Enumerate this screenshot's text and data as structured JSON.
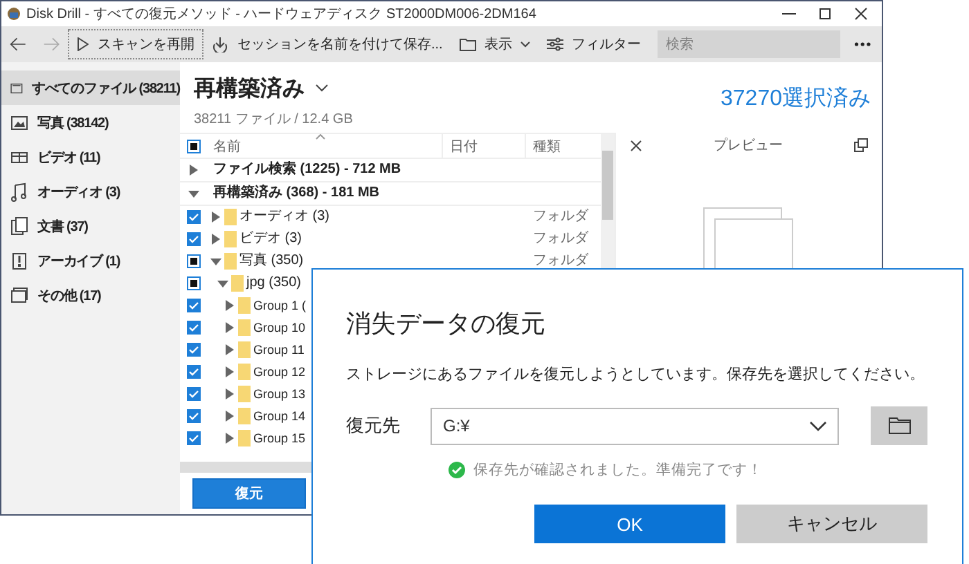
{
  "window": {
    "title": "Disk Drill - すべての復元メソッド - ハードウェアディスク ST2000DM006-2DM164"
  },
  "toolbar": {
    "rescan": "スキャンを再開",
    "save_session": "セッションを名前を付けて保存...",
    "view": "表示",
    "filter": "フィルター",
    "search": {
      "placeholder": "検索"
    }
  },
  "sidebar": {
    "items": [
      {
        "label": "すべてのファイル (38211)",
        "kind": "all",
        "selected": true
      },
      {
        "label": "写真 (38142)",
        "kind": "photo",
        "selected": false
      },
      {
        "label": "ビデオ (11)",
        "kind": "video",
        "selected": false
      },
      {
        "label": "オーディオ (3)",
        "kind": "audio",
        "selected": false
      },
      {
        "label": "文書 (37)",
        "kind": "document",
        "selected": false
      },
      {
        "label": "アーカイブ (1)",
        "kind": "archive",
        "selected": false
      },
      {
        "label": "その他 (17)",
        "kind": "other",
        "selected": false
      }
    ]
  },
  "content": {
    "title": "再構築済み",
    "summary": "38211 ファイル / 12.4 GB",
    "selected_count": "37270選択済み"
  },
  "table": {
    "header_checked": false,
    "header_indeterminate": true,
    "columns": [
      "名前",
      "日付",
      "種類"
    ],
    "rows": [
      {
        "kind": "section",
        "name": "ファイル検索 (1225) - 712 MB",
        "expanded": false
      },
      {
        "kind": "section",
        "name": "再構築済み (368) - 181 MB",
        "expanded": true,
        "children": [
          {
            "kind": "folder",
            "name": "オーディオ (3)",
            "checked": true,
            "expanded": false,
            "type": "フォルダ"
          },
          {
            "kind": "folder",
            "name": "ビデオ (3)",
            "checked": true,
            "expanded": false,
            "type": "フォルダ"
          },
          {
            "kind": "folder",
            "name": "写真 (350)",
            "checked": false,
            "indeterminate": true,
            "expanded": true,
            "type": "フォルダ",
            "children": [
              {
                "kind": "folder",
                "name": "jpg (350)",
                "checked": false,
                "indeterminate": true,
                "expanded": true,
                "children": [
                  {
                    "kind": "folder",
                    "name": "Group 1 (",
                    "checked": true,
                    "expanded": false
                  },
                  {
                    "kind": "folder",
                    "name": "Group 10",
                    "checked": true,
                    "expanded": false
                  },
                  {
                    "kind": "folder",
                    "name": "Group 11",
                    "checked": true,
                    "expanded": false
                  },
                  {
                    "kind": "folder",
                    "name": "Group 12",
                    "checked": true,
                    "expanded": false
                  },
                  {
                    "kind": "folder",
                    "name": "Group 13",
                    "checked": true,
                    "expanded": false
                  },
                  {
                    "kind": "folder",
                    "name": "Group 14",
                    "checked": true,
                    "expanded": false
                  },
                  {
                    "kind": "folder",
                    "name": "Group 15",
                    "checked": true,
                    "expanded": false
                  }
                ]
              }
            ]
          }
        ]
      }
    ]
  },
  "restore_button": "復元",
  "preview": {
    "title": "プレビュー"
  },
  "dialog": {
    "title": "消失データの復元",
    "message": "ストレージにあるファイルを復元しようとしています。保存先を選択してください。",
    "destination_label": "復元先",
    "destination_value": "G:¥",
    "status": "保存先が確認されました。準備完了です！",
    "ok": "OK",
    "cancel": "キャンセル"
  }
}
